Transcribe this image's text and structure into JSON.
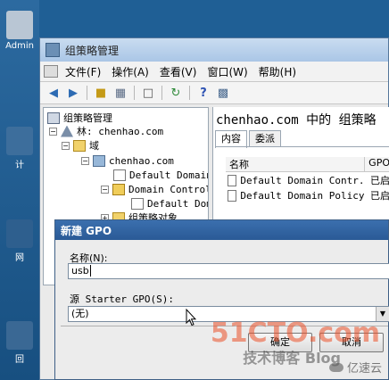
{
  "desktop": {
    "icons": [
      {
        "label": "Admin",
        "color": "#b9c6d4"
      },
      {
        "label": "计",
        "color": "#3d6e9c"
      },
      {
        "label": "网",
        "color": "#2e5f8e"
      },
      {
        "label": "回",
        "color": "#3a6894"
      }
    ]
  },
  "window": {
    "title": "组策略管理",
    "menu": [
      {
        "label": "文件(F)"
      },
      {
        "label": "操作(A)"
      },
      {
        "label": "查看(V)"
      },
      {
        "label": "窗口(W)"
      },
      {
        "label": "帮助(H)"
      }
    ],
    "toolbar_icons": [
      "back-icon",
      "forward-icon",
      "up-folder-icon",
      "show-hide-tree-icon",
      "properties-icon",
      "refresh-icon",
      "help-icon",
      "console-icon"
    ]
  },
  "tree": {
    "root": "组策略管理",
    "forest": "林: chenhao.com",
    "domains": "域",
    "domain": "chenhao.com",
    "gpo_link_1": "Default Domain",
    "ou": "Domain Control",
    "gpo_link_2": "Default Dom",
    "gpo_objects": "组策略对象"
  },
  "right_pane": {
    "title": "chenhao.com 中的 组策略",
    "tabs": [
      {
        "label": "内容"
      },
      {
        "label": "委派"
      }
    ],
    "columns": [
      "名称",
      "GPO"
    ],
    "rows": [
      {
        "name": "Default Domain Contr...",
        "status": "已启"
      },
      {
        "name": "Default Domain Policy",
        "status": "已启"
      }
    ]
  },
  "dialog": {
    "title": "新建 GPO",
    "name_label": "名称(N):",
    "name_value": "usb",
    "source_label": "源 Starter GPO(S):",
    "source_value": "(无)",
    "ok_label": "确定",
    "cancel_label": "取消"
  },
  "watermark": {
    "main": "51CTO.com",
    "sub": "技术博客 Blog",
    "cloud": "亿速云"
  }
}
